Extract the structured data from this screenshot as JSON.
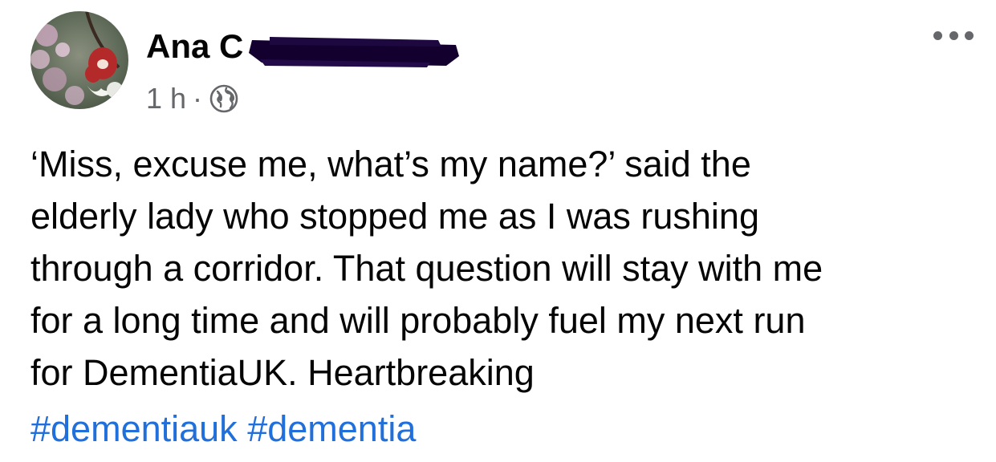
{
  "post": {
    "author_name": "Ana C",
    "timestamp": "1 h",
    "separator": "·",
    "privacy_icon": "globe-icon",
    "more_icon": "more-options-icon",
    "text_lines": [
      "‘Miss, excuse me, what’s my name?’ said the",
      "elderly lady who stopped me as I was rushing",
      "through a corridor. That question will stay with me",
      "for a long time and will probably fuel my next run",
      "for DementiaUK. Heartbreaking"
    ],
    "hashtags": [
      "#dementiauk",
      "#dementia"
    ]
  },
  "colors": {
    "text": "#050505",
    "secondary_text": "#65676b",
    "link": "#216fdb",
    "redaction": "#14002e"
  }
}
